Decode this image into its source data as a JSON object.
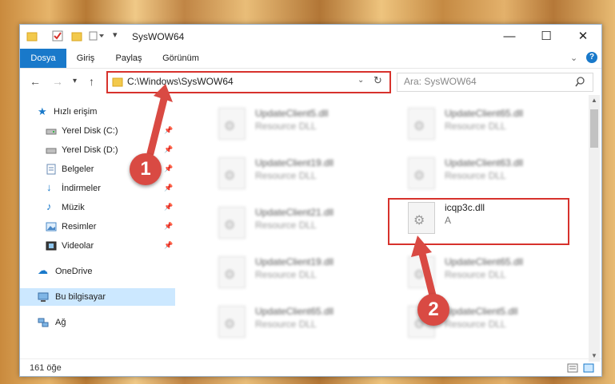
{
  "window": {
    "title": "SysWOW64",
    "controls": {
      "minimize": "—",
      "maximize": "☐",
      "close": "✕"
    }
  },
  "ribbon": {
    "tabs": [
      "Dosya",
      "Giriş",
      "Paylaş",
      "Görünüm"
    ],
    "active_tab": "Dosya",
    "help": "?"
  },
  "address": {
    "path": "C:\\Windows\\SysWOW64",
    "search_placeholder": "Ara: SysWOW64"
  },
  "nav_pane": {
    "quick_access": "Hızlı erişim",
    "items": [
      {
        "label": "Yerel Disk (C:)",
        "icon": "drive-icon"
      },
      {
        "label": "Yerel Disk (D:)",
        "icon": "drive-icon"
      },
      {
        "label": "Belgeler",
        "icon": "documents-icon"
      },
      {
        "label": "İndirmeler",
        "icon": "download-icon"
      },
      {
        "label": "Müzik",
        "icon": "music-icon"
      },
      {
        "label": "Resimler",
        "icon": "pictures-icon"
      },
      {
        "label": "Videolar",
        "icon": "videos-icon"
      }
    ],
    "onedrive": "OneDrive",
    "this_pc": "Bu bilgisayar",
    "network": "Ağ"
  },
  "files": {
    "col1": [
      {
        "name": "UpdateClient5.dll",
        "type": "Resource DLL"
      },
      {
        "name": "UpdateClient19.dll",
        "type": "Resource DLL"
      },
      {
        "name": "UpdateClient21.dll",
        "type": "Resource DLL"
      },
      {
        "name": "UpdateClient19.dll",
        "type": "Resource DLL"
      },
      {
        "name": "UpdateClient65.dll",
        "type": "Resource DLL"
      }
    ],
    "col2": [
      {
        "name": "UpdateClient65.dll",
        "type": "Resource DLL"
      },
      {
        "name": "UpdateClient63.dll",
        "type": "Resource DLL"
      },
      {
        "name": "icqp3c.dll",
        "type": "A"
      },
      {
        "name": "UpdateClient65.dll",
        "type": "Resource DLL"
      },
      {
        "name": "UpdateClient5.dll",
        "type": "Resource DLL"
      }
    ]
  },
  "status": {
    "count": "161 öğe"
  },
  "markers": {
    "one": "1",
    "two": "2"
  },
  "colors": {
    "accent": "#1979ca",
    "highlight": "#d7322c",
    "marker": "#d94a43"
  }
}
